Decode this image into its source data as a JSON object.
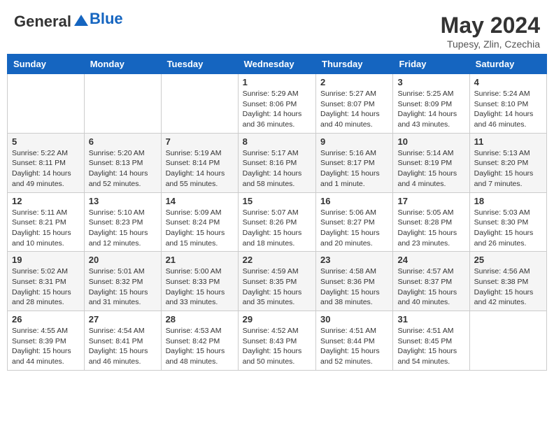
{
  "header": {
    "logo_general": "General",
    "logo_blue": "Blue",
    "month_year": "May 2024",
    "location": "Tupesy, Zlin, Czechia"
  },
  "days_of_week": [
    "Sunday",
    "Monday",
    "Tuesday",
    "Wednesday",
    "Thursday",
    "Friday",
    "Saturday"
  ],
  "weeks": [
    [
      {
        "day": "",
        "info": ""
      },
      {
        "day": "",
        "info": ""
      },
      {
        "day": "",
        "info": ""
      },
      {
        "day": "1",
        "info": "Sunrise: 5:29 AM\nSunset: 8:06 PM\nDaylight: 14 hours and 36 minutes."
      },
      {
        "day": "2",
        "info": "Sunrise: 5:27 AM\nSunset: 8:07 PM\nDaylight: 14 hours and 40 minutes."
      },
      {
        "day": "3",
        "info": "Sunrise: 5:25 AM\nSunset: 8:09 PM\nDaylight: 14 hours and 43 minutes."
      },
      {
        "day": "4",
        "info": "Sunrise: 5:24 AM\nSunset: 8:10 PM\nDaylight: 14 hours and 46 minutes."
      }
    ],
    [
      {
        "day": "5",
        "info": "Sunrise: 5:22 AM\nSunset: 8:11 PM\nDaylight: 14 hours and 49 minutes."
      },
      {
        "day": "6",
        "info": "Sunrise: 5:20 AM\nSunset: 8:13 PM\nDaylight: 14 hours and 52 minutes."
      },
      {
        "day": "7",
        "info": "Sunrise: 5:19 AM\nSunset: 8:14 PM\nDaylight: 14 hours and 55 minutes."
      },
      {
        "day": "8",
        "info": "Sunrise: 5:17 AM\nSunset: 8:16 PM\nDaylight: 14 hours and 58 minutes."
      },
      {
        "day": "9",
        "info": "Sunrise: 5:16 AM\nSunset: 8:17 PM\nDaylight: 15 hours and 1 minute."
      },
      {
        "day": "10",
        "info": "Sunrise: 5:14 AM\nSunset: 8:19 PM\nDaylight: 15 hours and 4 minutes."
      },
      {
        "day": "11",
        "info": "Sunrise: 5:13 AM\nSunset: 8:20 PM\nDaylight: 15 hours and 7 minutes."
      }
    ],
    [
      {
        "day": "12",
        "info": "Sunrise: 5:11 AM\nSunset: 8:21 PM\nDaylight: 15 hours and 10 minutes."
      },
      {
        "day": "13",
        "info": "Sunrise: 5:10 AM\nSunset: 8:23 PM\nDaylight: 15 hours and 12 minutes."
      },
      {
        "day": "14",
        "info": "Sunrise: 5:09 AM\nSunset: 8:24 PM\nDaylight: 15 hours and 15 minutes."
      },
      {
        "day": "15",
        "info": "Sunrise: 5:07 AM\nSunset: 8:26 PM\nDaylight: 15 hours and 18 minutes."
      },
      {
        "day": "16",
        "info": "Sunrise: 5:06 AM\nSunset: 8:27 PM\nDaylight: 15 hours and 20 minutes."
      },
      {
        "day": "17",
        "info": "Sunrise: 5:05 AM\nSunset: 8:28 PM\nDaylight: 15 hours and 23 minutes."
      },
      {
        "day": "18",
        "info": "Sunrise: 5:03 AM\nSunset: 8:30 PM\nDaylight: 15 hours and 26 minutes."
      }
    ],
    [
      {
        "day": "19",
        "info": "Sunrise: 5:02 AM\nSunset: 8:31 PM\nDaylight: 15 hours and 28 minutes."
      },
      {
        "day": "20",
        "info": "Sunrise: 5:01 AM\nSunset: 8:32 PM\nDaylight: 15 hours and 31 minutes."
      },
      {
        "day": "21",
        "info": "Sunrise: 5:00 AM\nSunset: 8:33 PM\nDaylight: 15 hours and 33 minutes."
      },
      {
        "day": "22",
        "info": "Sunrise: 4:59 AM\nSunset: 8:35 PM\nDaylight: 15 hours and 35 minutes."
      },
      {
        "day": "23",
        "info": "Sunrise: 4:58 AM\nSunset: 8:36 PM\nDaylight: 15 hours and 38 minutes."
      },
      {
        "day": "24",
        "info": "Sunrise: 4:57 AM\nSunset: 8:37 PM\nDaylight: 15 hours and 40 minutes."
      },
      {
        "day": "25",
        "info": "Sunrise: 4:56 AM\nSunset: 8:38 PM\nDaylight: 15 hours and 42 minutes."
      }
    ],
    [
      {
        "day": "26",
        "info": "Sunrise: 4:55 AM\nSunset: 8:39 PM\nDaylight: 15 hours and 44 minutes."
      },
      {
        "day": "27",
        "info": "Sunrise: 4:54 AM\nSunset: 8:41 PM\nDaylight: 15 hours and 46 minutes."
      },
      {
        "day": "28",
        "info": "Sunrise: 4:53 AM\nSunset: 8:42 PM\nDaylight: 15 hours and 48 minutes."
      },
      {
        "day": "29",
        "info": "Sunrise: 4:52 AM\nSunset: 8:43 PM\nDaylight: 15 hours and 50 minutes."
      },
      {
        "day": "30",
        "info": "Sunrise: 4:51 AM\nSunset: 8:44 PM\nDaylight: 15 hours and 52 minutes."
      },
      {
        "day": "31",
        "info": "Sunrise: 4:51 AM\nSunset: 8:45 PM\nDaylight: 15 hours and 54 minutes."
      },
      {
        "day": "",
        "info": ""
      }
    ]
  ]
}
